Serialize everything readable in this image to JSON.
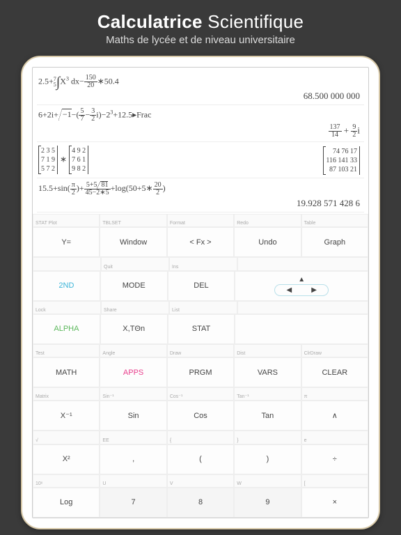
{
  "header": {
    "title_bold": "Calculatrice",
    "title_rest": " Scientifique",
    "subtitle": "Maths de lycée et de niveau universitaire"
  },
  "display": {
    "r1": {
      "a": "2.5+",
      "int_hi": "7",
      "int_lo": "5",
      "b": "X",
      "exp": "3",
      "c": " dx−",
      "f_n": "150",
      "f_d": "20",
      "d": "∗50.4",
      "result": "68.500 000 000"
    },
    "r2": {
      "a": "6+2i+",
      "sq": "−1",
      "b": "−",
      "f1n": "5",
      "f1d": "7",
      "c": "−",
      "f2n": "3",
      "f2d": "2",
      "d": "i",
      "e": "−2",
      "exp": "3",
      "f": "+12.5▸Frac",
      "res_f1n": "137",
      "res_f1d": "14",
      "res_plus": " + ",
      "res_f2n": "9",
      "res_f2d": "2",
      "res_i": "i"
    },
    "r3": {
      "m1": [
        "2 3 5",
        "7 1 9",
        "5 7 2"
      ],
      "star": "∗",
      "m2": [
        "4 9 2",
        "7 6 1",
        "9 8 2"
      ],
      "mr": [
        "74  76 17",
        "116 141 33",
        "87  103 21"
      ]
    },
    "r4": {
      "a": "15.5+sin",
      "f1n": "π",
      "f1d": "2",
      "b": "+",
      "f2n_a": "5+5",
      "f2n_sq": "81",
      "f2d": "45−2∗5",
      "c": "+log",
      "d": "50+5∗",
      "f3n": "20",
      "f3d": "2",
      "result": "19.928 571 428 6"
    }
  },
  "labels": {
    "l1": [
      "STAT Plot",
      "TBLSET",
      "Format",
      "Redo",
      "Table"
    ],
    "k1": [
      "Y=",
      "Window",
      "< Fx >",
      "Undo",
      "Graph"
    ],
    "l2": [
      "",
      "Quit",
      "Ins",
      "",
      ""
    ],
    "k2": [
      "2ND",
      "MODE",
      "DEL"
    ],
    "l3": [
      "Lock",
      "Share",
      "List",
      "",
      ""
    ],
    "k3": [
      "ALPHA",
      "X,TΘn",
      "STAT"
    ],
    "l4": [
      "Test",
      "Angle",
      "Draw",
      "Dist",
      "ClrDraw"
    ],
    "k4": [
      "MATH",
      "APPS",
      "PRGM",
      "VARS",
      "CLEAR"
    ],
    "l5": [
      "Matrix",
      "Sin⁻¹",
      "Cos⁻¹",
      "Tan⁻¹",
      "π"
    ],
    "k5": [
      "X⁻¹",
      "Sin",
      "Cos",
      "Tan",
      "∧"
    ],
    "l6": [
      "√",
      "EE",
      "{",
      "}",
      "e"
    ],
    "k6": [
      "X²",
      ",",
      "(",
      ")",
      "÷"
    ],
    "l7": [
      "10ˣ",
      "U",
      "V",
      "W",
      "["
    ],
    "k7": [
      "Log",
      "7",
      "8",
      "9",
      "×"
    ]
  },
  "arrows": {
    "up": "▲",
    "left": "◀",
    "right": "▶"
  }
}
